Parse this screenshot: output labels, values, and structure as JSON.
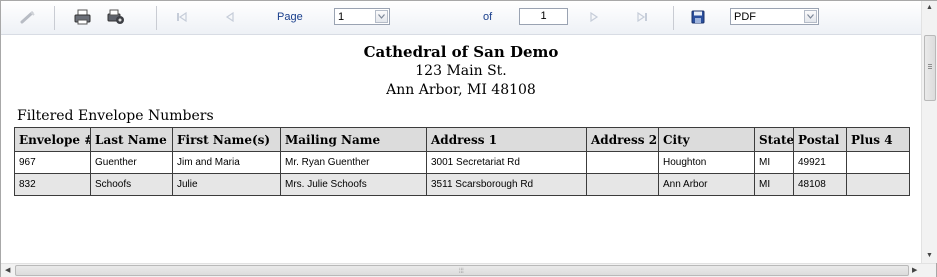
{
  "toolbar": {
    "page_label": "Page",
    "page_select_value": "1",
    "of_label": "of",
    "total_pages": "1",
    "export_format": "PDF",
    "icons": [
      "wand-icon",
      "print-icon",
      "print-options-icon",
      "first-page-icon",
      "previous-page-icon",
      "next-page-icon",
      "last-page-icon",
      "save-icon"
    ]
  },
  "report": {
    "org_name": "Cathedral of San Demo",
    "address_line1": "123 Main St.",
    "address_line2": "Ann Arbor, MI 48108",
    "section_title": "Filtered Envelope Numbers"
  },
  "table": {
    "columns": [
      "Envelope #",
      "Last Name",
      "First Name(s)",
      "Mailing Name",
      "Address 1",
      "Address 2",
      "City",
      "State",
      "Postal",
      "Plus 4"
    ],
    "rows": [
      [
        "967",
        "Guenther",
        "Jim and Maria",
        "Mr. Ryan Guenther",
        "3001 Secretariat Rd",
        "",
        "Houghton",
        "MI",
        "49921",
        ""
      ],
      [
        "832",
        "Schoofs",
        "Julie",
        "Mrs. Julie Schoofs",
        "3511 Scarsborough Rd",
        "",
        "Ann Arbor",
        "MI",
        "48108",
        ""
      ]
    ]
  },
  "colors": {
    "header_bg": "#dcdcdc",
    "alt_row_bg": "#e6e6e6",
    "toolbar_text": "#1a3f8c"
  }
}
